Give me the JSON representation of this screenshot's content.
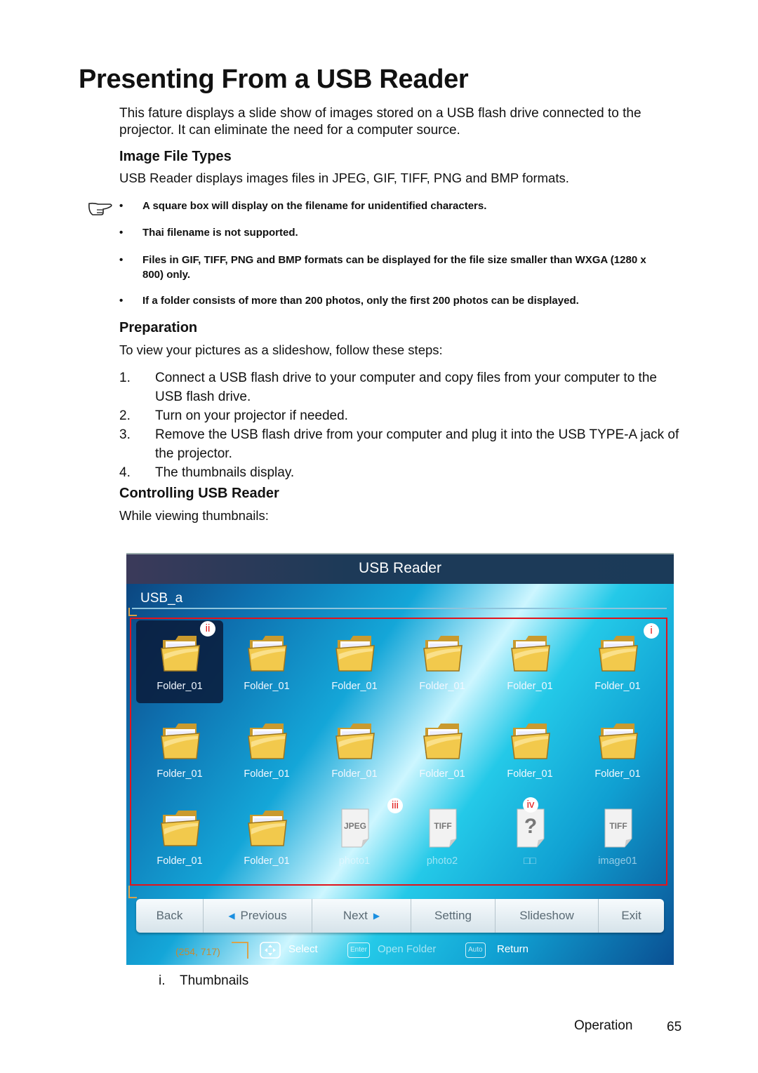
{
  "page": {
    "title": "Presenting From a USB Reader",
    "intro": "This fature displays a slide show of images stored on a USB flash drive connected to the projector. It can eliminate the need for a computer source.",
    "sections": {
      "image_file_types": {
        "heading": "Image File Types",
        "text": "USB Reader displays images files in JPEG, GIF, TIFF, PNG and BMP formats."
      },
      "notes": {
        "icon": "pointing-hand-icon",
        "items": [
          "A square box will display on the filename for unidentified characters.",
          "Thai filename is not supported.",
          "Files in GIF, TIFF, PNG and BMP formats can be displayed for the file size smaller than WXGA (1280 x 800) only.",
          "If a folder consists of more than 200 photos, only the first 200 photos can be displayed."
        ]
      },
      "preparation": {
        "heading": "Preparation",
        "text": "To view your pictures as a slideshow, follow these steps:",
        "steps": [
          {
            "num": "1.",
            "text": "Connect a USB flash drive to your computer and copy files from your computer to the USB flash drive."
          },
          {
            "num": "2.",
            "text": "Turn on your projector if needed."
          },
          {
            "num": "3.",
            "text": "Remove the USB flash drive from your computer and plug it into the USB TYPE-A jack of the projector."
          },
          {
            "num": "4.",
            "text": "The thumbnails display."
          }
        ]
      },
      "controlling": {
        "heading": "Controlling USB Reader",
        "text": "While viewing thumbnails:"
      }
    },
    "bullet": "•"
  },
  "screen": {
    "title": "USB Reader",
    "path": "USB_a",
    "markers": [
      "i",
      "ii",
      "iii",
      "iv"
    ],
    "tiles": [
      {
        "type": "folder",
        "label": "Folder_01",
        "selected": true
      },
      {
        "type": "folder",
        "label": "Folder_01"
      },
      {
        "type": "folder",
        "label": "Folder_01"
      },
      {
        "type": "folder",
        "label": "Folder_01"
      },
      {
        "type": "folder",
        "label": "Folder_01"
      },
      {
        "type": "folder",
        "label": "Folder_01"
      },
      {
        "type": "folder",
        "label": "Folder_01"
      },
      {
        "type": "folder",
        "label": "Folder_01"
      },
      {
        "type": "folder",
        "label": "Folder_01"
      },
      {
        "type": "folder",
        "label": "Folder_01"
      },
      {
        "type": "folder",
        "label": "Folder_01"
      },
      {
        "type": "folder",
        "label": "Folder_01"
      },
      {
        "type": "folder",
        "label": "Folder_01"
      },
      {
        "type": "folder",
        "label": "Folder_01"
      },
      {
        "type": "file",
        "badge": "JPEG",
        "label": "photo1"
      },
      {
        "type": "file",
        "badge": "TIFF",
        "label": "photo2"
      },
      {
        "type": "file",
        "badge": "?",
        "label": "□□"
      },
      {
        "type": "file",
        "badge": "TIFF",
        "label": "image01"
      }
    ],
    "buttons": {
      "back": "Back",
      "previous": "Previous",
      "next": "Next",
      "setting": "Setting",
      "slideshow": "Slideshow",
      "exit": "Exit"
    },
    "hints": {
      "coord": "(254, 717)",
      "select": "Select",
      "enter_key": "Enter",
      "open_folder": "Open Folder",
      "auto_key": "Auto",
      "return": "Return"
    },
    "colors": {
      "highlight_frame": "#e3131b",
      "marker_text": "#e01010"
    }
  },
  "caption": {
    "num": "i.",
    "text": "Thumbnails"
  },
  "footer": {
    "section": "Operation",
    "page": "65"
  }
}
